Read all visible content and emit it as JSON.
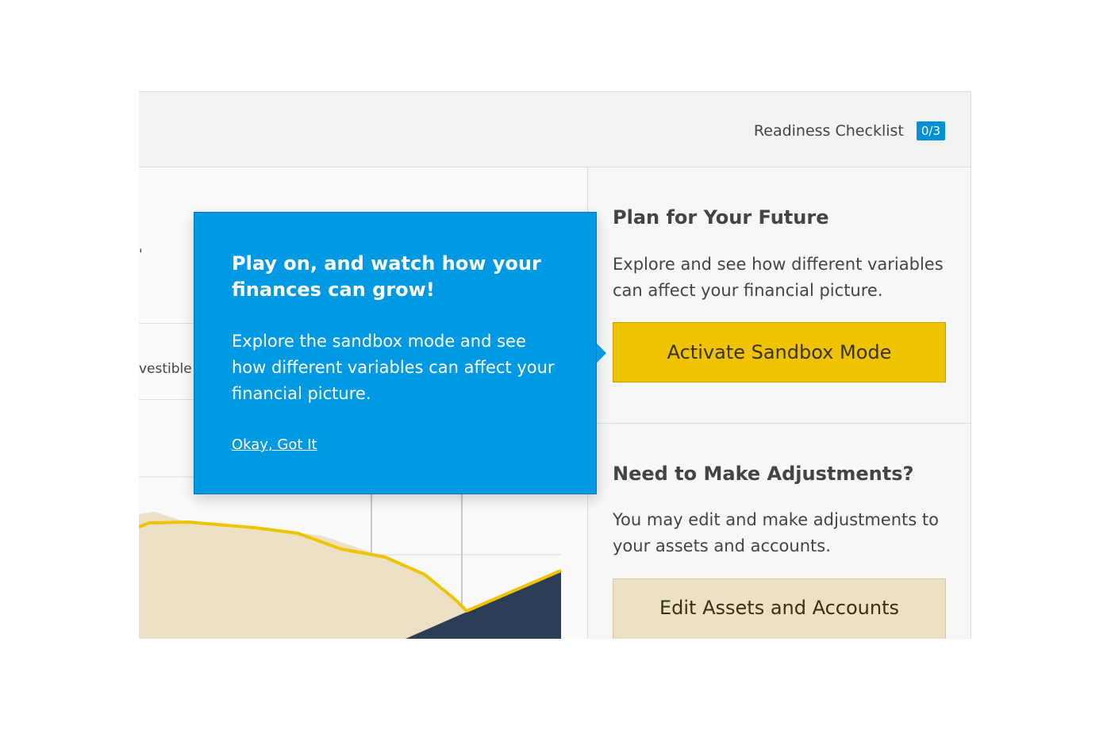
{
  "header": {
    "checklist_label": "Readiness Checklist",
    "checklist_count": "0/3",
    "badge_color": "#0090d8"
  },
  "left_panel": {
    "row_label_fragment": "'",
    "row_label": "vestible"
  },
  "chart_data": {
    "type": "area",
    "series": [
      {
        "color": "#ece1c5",
        "style": "filled-area"
      },
      {
        "color": "#f0c300",
        "style": "line"
      },
      {
        "color": "#2c3e55",
        "style": "filled-area"
      }
    ],
    "grid": true
  },
  "tooltip": {
    "title": "Play on, and watch how your finances can grow!",
    "text": "Explore the sandbox mode and see how different variables can affect your financial picture.",
    "link": "Okay, Got It",
    "background": "#0099e3"
  },
  "plan_section": {
    "title": "Plan for Your Future",
    "text": "Explore and see how different variables can affect your financial picture.",
    "button_label": "Activate Sandbox Mode",
    "button_color": "#f0c300"
  },
  "adjust_section": {
    "title": "Need to Make Adjustments?",
    "text": "You may edit and make adjustments to your assets and accounts.",
    "button_label": "Edit Assets and Accounts",
    "button_color": "#ece1c5"
  }
}
